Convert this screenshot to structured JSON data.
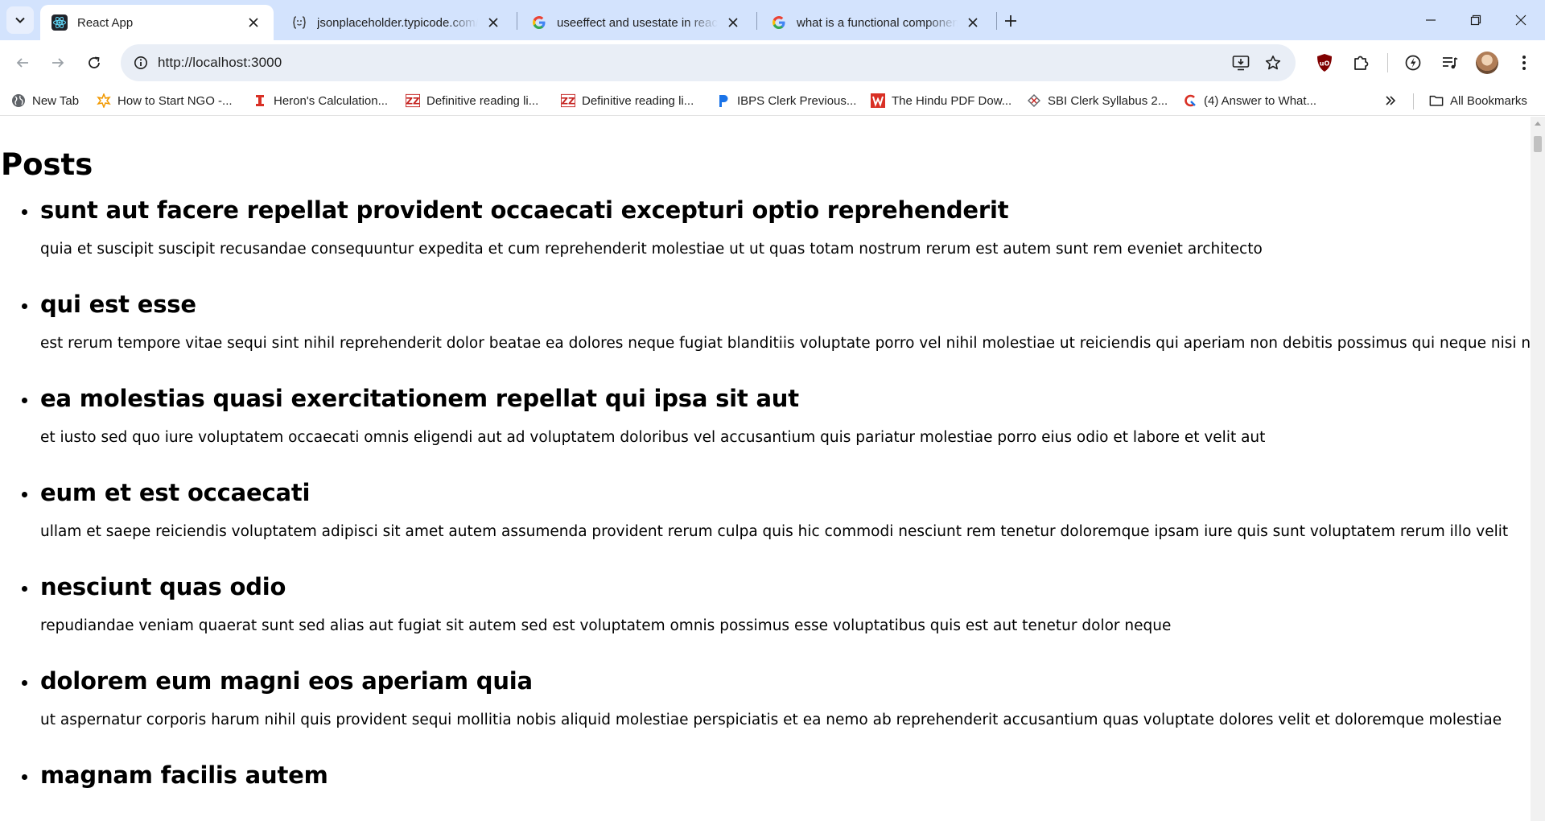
{
  "browser": {
    "tabs": [
      {
        "title": "React App",
        "icon": "react-icon",
        "active": true
      },
      {
        "title": "jsonplaceholder.typicode.com/p",
        "icon": "jsonplaceholder-icon",
        "active": false
      },
      {
        "title": "useeffect and usestate in react -",
        "icon": "google-icon",
        "active": false
      },
      {
        "title": "what is a functional component",
        "icon": "google-icon",
        "active": false
      }
    ],
    "new_tab_symbol": "+",
    "address": "http://localhost:3000",
    "bookmarks": [
      {
        "label": "New Tab",
        "icon": "globe-icon",
        "icon_color": "#5f6368"
      },
      {
        "label": "How to Start NGO -...",
        "icon": "gear-star-icon",
        "icon_color": "#f29900"
      },
      {
        "label": "Heron's Calculation...",
        "icon": "i-beam-icon",
        "icon_color": "#d93025"
      },
      {
        "label": "Definitive reading li...",
        "icon": "zz-red-icon",
        "icon_color": "#c5221f"
      },
      {
        "label": "Definitive reading li...",
        "icon": "zz-red-icon",
        "icon_color": "#c5221f"
      },
      {
        "label": "IBPS Clerk Previous...",
        "icon": "p-blue-icon",
        "icon_color": "#1a73e8"
      },
      {
        "label": "The Hindu PDF Dow...",
        "icon": "w-red-icon",
        "icon_color": "#d93025"
      },
      {
        "label": "SBI Clerk Syllabus 2...",
        "icon": "sbi-icon",
        "icon_color": "#5f6368"
      },
      {
        "label": "(4) Answer to What...",
        "icon": "quora-icon",
        "icon_color": "#d93025"
      }
    ],
    "all_bookmarks_label": "All Bookmarks",
    "accent_color": "#d3e3fd"
  },
  "page": {
    "heading": "Posts",
    "posts": [
      {
        "title": "sunt aut facere repellat provident occaecati excepturi optio reprehenderit",
        "body": "quia et suscipit suscipit recusandae consequuntur expedita et cum reprehenderit molestiae ut ut quas totam nostrum rerum est autem sunt rem eveniet architecto"
      },
      {
        "title": "qui est esse",
        "body": "est rerum tempore vitae sequi sint nihil reprehenderit dolor beatae ea dolores neque fugiat blanditiis voluptate porro vel nihil molestiae ut reiciendis qui aperiam non debitis possimus qui neque nisi nulla"
      },
      {
        "title": "ea molestias quasi exercitationem repellat qui ipsa sit aut",
        "body": "et iusto sed quo iure voluptatem occaecati omnis eligendi aut ad voluptatem doloribus vel accusantium quis pariatur molestiae porro eius odio et labore et velit aut"
      },
      {
        "title": "eum et est occaecati",
        "body": "ullam et saepe reiciendis voluptatem adipisci sit amet autem assumenda provident rerum culpa quis hic commodi nesciunt rem tenetur doloremque ipsam iure quis sunt voluptatem rerum illo velit"
      },
      {
        "title": "nesciunt quas odio",
        "body": "repudiandae veniam quaerat sunt sed alias aut fugiat sit autem sed est voluptatem omnis possimus esse voluptatibus quis est aut tenetur dolor neque"
      },
      {
        "title": "dolorem eum magni eos aperiam quia",
        "body": "ut aspernatur corporis harum nihil quis provident sequi mollitia nobis aliquid molestiae perspiciatis et ea nemo ab reprehenderit accusantium quas voluptate dolores velit et doloremque molestiae"
      },
      {
        "title": "magnam facilis autem",
        "body": ""
      }
    ]
  }
}
